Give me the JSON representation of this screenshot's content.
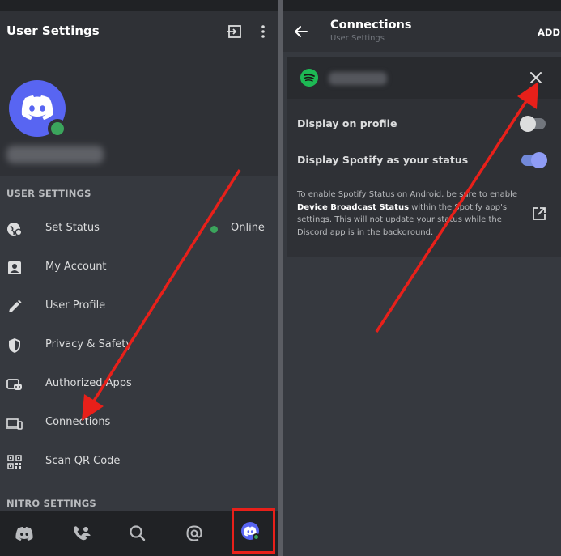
{
  "left": {
    "header": {
      "title": "User Settings",
      "logout_icon": "logout-icon",
      "menu_icon": "kebab-icon"
    },
    "profile": {
      "avatar_icon": "discord-logo-icon",
      "status": "online"
    },
    "sections": {
      "user_settings": "USER SETTINGS",
      "nitro_settings": "NITRO SETTINGS"
    },
    "items": [
      {
        "label": "Set Status",
        "icon": "status-icon",
        "value": "Online"
      },
      {
        "label": "My Account",
        "icon": "account-icon"
      },
      {
        "label": "User Profile",
        "icon": "pencil-icon"
      },
      {
        "label": "Privacy & Safety",
        "icon": "shield-icon"
      },
      {
        "label": "Authorized Apps",
        "icon": "gamepad-icon"
      },
      {
        "label": "Connections",
        "icon": "devices-icon"
      },
      {
        "label": "Scan QR Code",
        "icon": "qr-code-icon"
      }
    ],
    "bottom_nav": [
      "discord-home-icon",
      "friends-icon",
      "search-icon",
      "mentions-icon",
      "profile-avatar-icon"
    ]
  },
  "right": {
    "header": {
      "title": "Connections",
      "subtitle": "User Settings",
      "add_label": "ADD"
    },
    "connection": {
      "service_icon": "spotify-icon",
      "display_on_profile_label": "Display on profile",
      "display_on_profile": false,
      "display_status_label": "Display Spotify as your status",
      "display_status": true,
      "note_part1": "To enable Spotify Status on Android, be sure to enable ",
      "note_bold": "Device Broadcast Status",
      "note_part2": " within the Spotify app's settings. This will not update your status while the Discord app is in the background."
    }
  },
  "colors": {
    "accent": "#5865f2",
    "online": "#3ba55c",
    "spotify": "#1db954",
    "annotation_red": "#e8201a"
  }
}
